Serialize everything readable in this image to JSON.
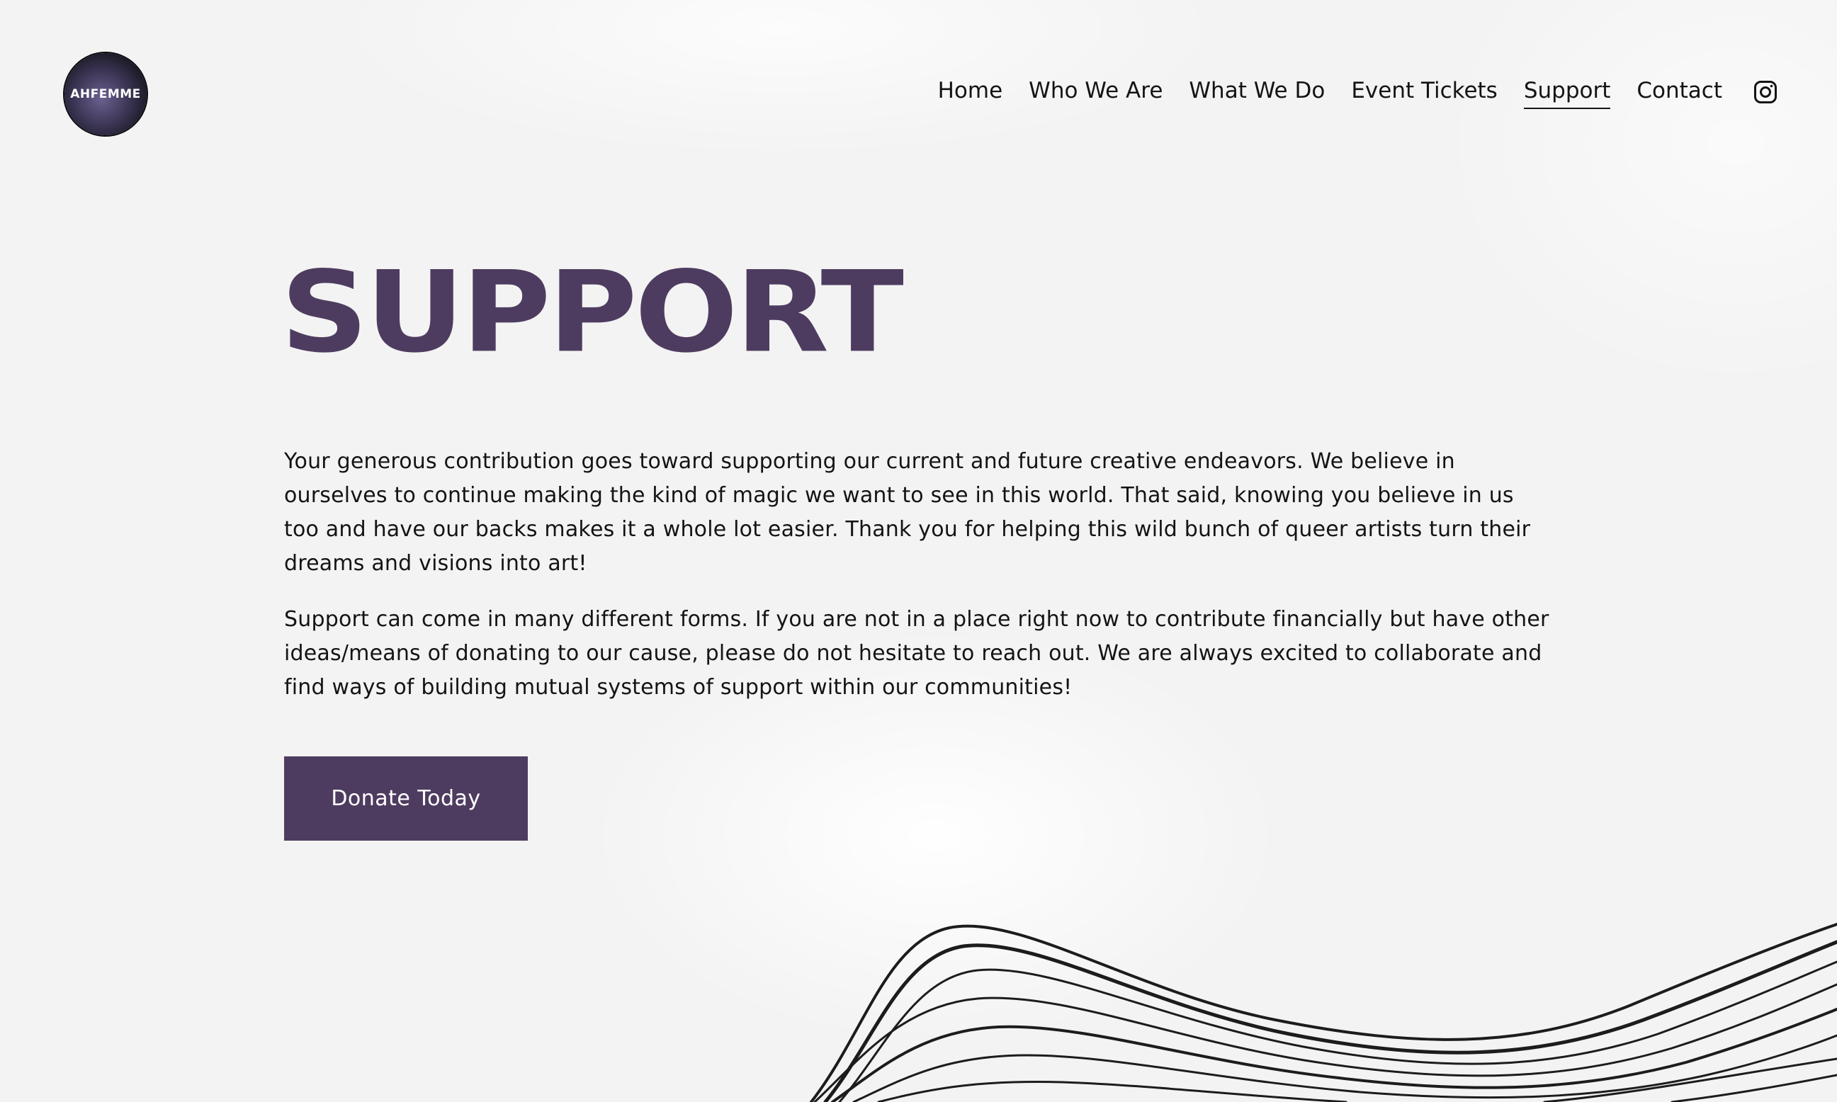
{
  "brand": {
    "logo_text": "AHFEMME"
  },
  "nav": {
    "items": [
      {
        "label": "Home"
      },
      {
        "label": "Who We Are"
      },
      {
        "label": "What We Do"
      },
      {
        "label": "Event Tickets"
      },
      {
        "label": "Support",
        "active": true
      },
      {
        "label": "Contact"
      }
    ],
    "social_icon": "instagram-icon"
  },
  "main": {
    "title": "SUPPORT",
    "paragraphs": [
      "Your generous contribution goes toward supporting our current and future creative endeavors. We believe in ourselves to continue making the kind of magic we want to see in this world. That said, knowing you believe in us too and have our backs makes it a whole lot easier. Thank you for helping this wild bunch of queer artists turn their dreams and visions into art!",
      "Support can come in many different forms. If you are not in a place right now to contribute financially but have other ideas/means of donating to our cause, please do not hesitate to reach out. We are always excited to collaborate and find ways of building mutual systems of support within our communities!"
    ],
    "cta_label": "Donate Today"
  },
  "colors": {
    "accent": "#4e3c60",
    "background": "#f3f3f3",
    "text": "#141414",
    "button_text": "#ffffff"
  }
}
